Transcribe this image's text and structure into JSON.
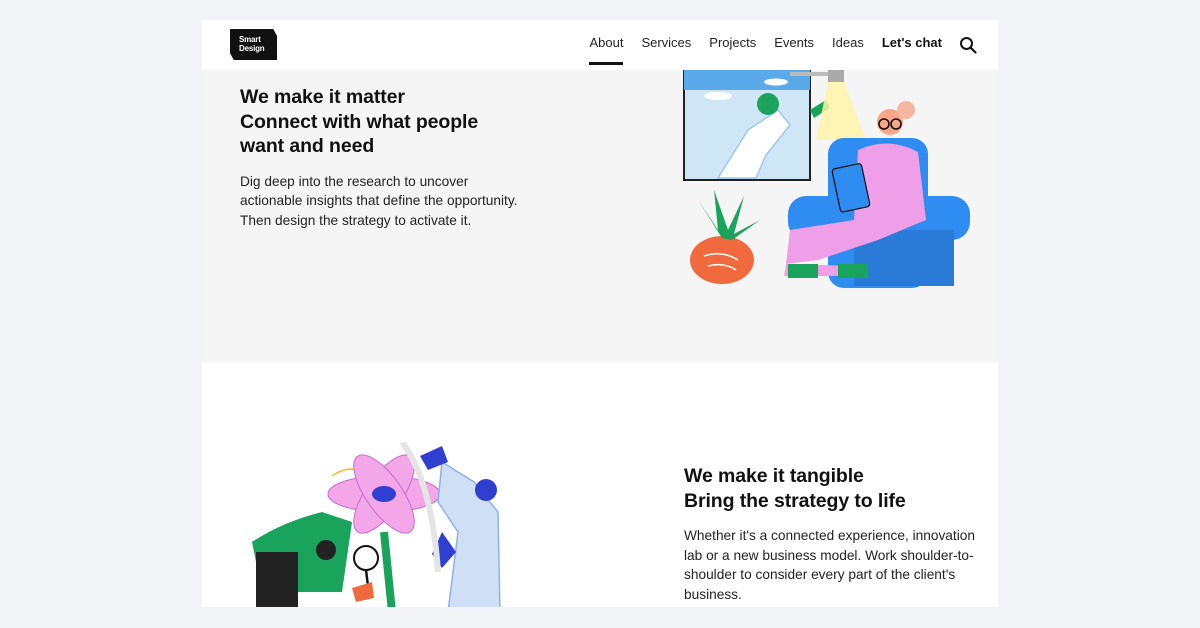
{
  "logo": {
    "line1": "Smart",
    "line2": "Design"
  },
  "nav": {
    "items": [
      "About",
      "Services",
      "Projects",
      "Events",
      "Ideas"
    ],
    "active": "About",
    "cta": "Let's chat",
    "search_icon": "search-icon"
  },
  "section1": {
    "heading_line1": "We make it matter",
    "heading_line2": "Connect with what people",
    "heading_line3": "want and need",
    "body": "Dig deep into the research to uncover actionable insights that define the opportunity. Then design the strategy to activate it."
  },
  "section2": {
    "heading_line1": "We make it tangible",
    "heading_line2": "Bring the strategy to life",
    "body": "Whether it's a connected experience, innovation lab or a new business model. Work shoulder-to-shoulder to consider every part of the client's business."
  },
  "colors": {
    "page_bg": "#f3f4f7",
    "section_gray": "#f5f5f5",
    "text": "#111111",
    "accent_blue": "#2f8cf0",
    "accent_green": "#1aa35a",
    "accent_pink": "#f3a6e8",
    "accent_orange": "#f06a3e"
  }
}
